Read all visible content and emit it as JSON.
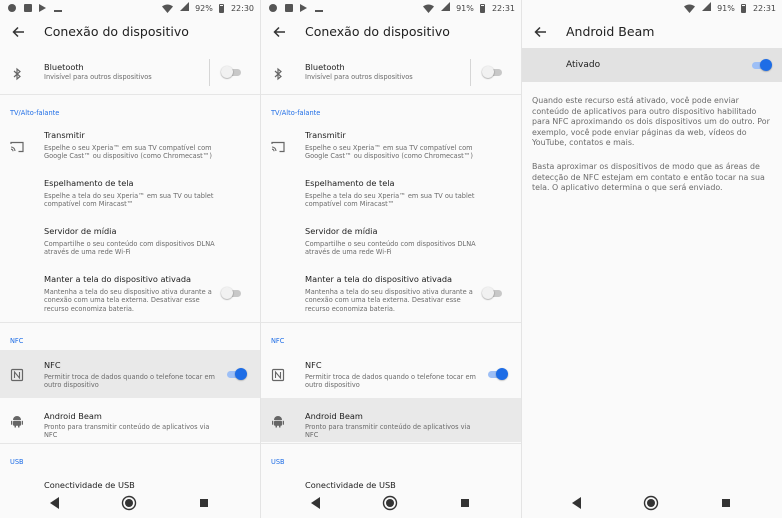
{
  "colors": {
    "accent": "#1e6de6",
    "background": "#fafafa",
    "highlight": "#e9e9e9"
  },
  "panels": [
    {
      "status": {
        "battery": "92%",
        "time": "22:30"
      },
      "title": "Conexão do dispositivo",
      "highlighted": "nfc"
    },
    {
      "status": {
        "battery": "91%",
        "time": "22:31"
      },
      "title": "Conexão do dispositivo",
      "highlighted": "beam"
    },
    {
      "status": {
        "battery": "91%",
        "time": "22:31"
      },
      "title": "Android Beam"
    }
  ],
  "settings": {
    "bluetooth": {
      "title": "Bluetooth",
      "subtitle": "Invisível para outros dispositivos",
      "icon": "bluetooth-icon",
      "toggle": false
    },
    "section_tv": "TV/Alto-falante",
    "transmitir": {
      "title": "Transmitir",
      "subtitle": "Espelhe o seu Xperia™ em sua TV compatível com Google Cast™ ou dispositivo (como Chromecast™)",
      "icon": "cast-icon"
    },
    "espelhamento": {
      "title": "Espelhamento de tela",
      "subtitle": "Espelhe a tela do seu Xperia™ em sua TV ou tablet compatível com Miracast™"
    },
    "servidor": {
      "title": "Servidor de mídia",
      "subtitle": "Compartilhe o seu conteúdo com dispositivos DLNA através de uma rede Wi-Fi"
    },
    "manter": {
      "title": "Manter a tela do dispositivo ativada",
      "subtitle": "Mantenha a tela do seu dispositivo ativa durante a conexão com uma tela externa. Desativar esse recurso economiza bateria.",
      "toggle": false
    },
    "section_nfc": "NFC",
    "nfc": {
      "title": "NFC",
      "subtitle": "Permitir troca de dados quando o telefone tocar em outro dispositivo",
      "icon": "nfc-icon",
      "toggle": true
    },
    "beam": {
      "title": "Android Beam",
      "subtitle": "Pronto para transmitir conteúdo de aplicativos via NFC",
      "icon": "android-icon"
    },
    "section_usb": "USB",
    "usb": {
      "title": "Conectividade de USB"
    }
  },
  "beam_page": {
    "switch_label": "Ativado",
    "switch_on": true,
    "paragraph1": "Quando este recurso está ativado, você pode enviar conteúdo de aplicativos para outro dispositivo habilitado para NFC aproximando os dois dispositivos um do outro. Por exemplo, você pode enviar páginas da web, vídeos do YouTube, contatos e mais.",
    "paragraph2": "Basta aproximar os dispositivos de modo que as áreas de detecção de NFC estejam em contato e então tocar na sua tela. O aplicativo determina o que será enviado."
  },
  "nav": {
    "back": "back-triangle-icon",
    "home": "home-circle-icon",
    "recents": "recents-square-icon"
  }
}
